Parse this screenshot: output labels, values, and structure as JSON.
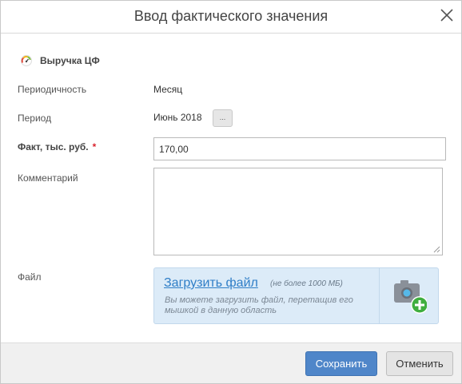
{
  "dialog": {
    "title": "Ввод фактического значения"
  },
  "kpi": {
    "name": "Выручка ЦФ"
  },
  "form": {
    "periodicity_label": "Периодичность",
    "periodicity_value": "Месяц",
    "period_label": "Период",
    "period_value": "Июнь 2018",
    "period_button_label": "...",
    "fact_label": "Факт, тыс. руб.",
    "fact_required_mark": "*",
    "fact_value": "170,00",
    "comment_label": "Комментарий",
    "comment_value": "",
    "file_label": "Файл"
  },
  "upload": {
    "link_label": "Загрузить файл",
    "limit_text": "(не более 1000 МБ)",
    "hint_text": "Вы можете загрузить файл, перетащив его мышкой в данную область"
  },
  "footer": {
    "save_label": "Сохранить",
    "cancel_label": "Отменить"
  },
  "colors": {
    "accent": "#4f86c9",
    "upload_bg": "#dcebf8",
    "link": "#2f7ec7",
    "required": "#d9232e"
  },
  "icons": {
    "close": "close-icon",
    "kpi": "gauge-icon",
    "camera_add": "camera-add-icon"
  }
}
